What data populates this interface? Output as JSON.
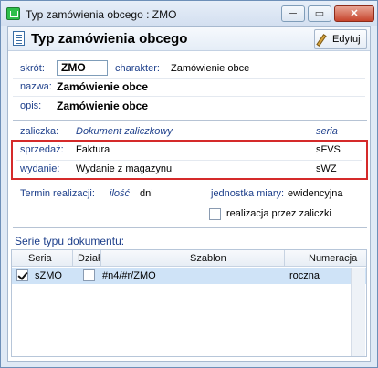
{
  "window": {
    "title": "Typ zamówienia obcego : ZMO",
    "minimize": "─",
    "maximize": "▭",
    "close": "✕"
  },
  "header": {
    "title": "Typ zamówienia obcego",
    "edit_label": "Edytuj"
  },
  "form": {
    "skrot_label": "skrót:",
    "skrot_value": "ZMO",
    "charakter_label": "charakter:",
    "charakter_value": "Zamówienie obce",
    "nazwa_label": "nazwa:",
    "nazwa_value": "Zamówienie obce",
    "opis_label": "opis:",
    "opis_value": "Zamówienie obce",
    "zaliczka_label": "zaliczka:",
    "zaliczka_value": "Dokument zaliczkowy",
    "seria_header": "seria",
    "sprzedaz_label": "sprzedaż:",
    "sprzedaz_value": "Faktura",
    "sprzedaz_seria": "sFVS",
    "wydanie_label": "wydanie:",
    "wydanie_value": "Wydanie z magazynu",
    "wydanie_seria": "sWZ",
    "termin_label": "Termin realizacji:",
    "termin_value": "ilość",
    "termin_unit": "dni",
    "jednostka_label": "jednostka miary:",
    "jednostka_value": "ewidencyjna",
    "realizacja_label": "realizacja przez zaliczki",
    "realizacja_checked": false
  },
  "series_section": {
    "title": "Serie typu dokumentu:",
    "columns": [
      "Seria",
      "Dział",
      "Szablon",
      "Numeracja"
    ],
    "rows": [
      {
        "checked": true,
        "seria": "sZMO",
        "dzial_checked": false,
        "szablon": "#n4/#r/ZMO",
        "numeracja": "roczna"
      }
    ]
  }
}
